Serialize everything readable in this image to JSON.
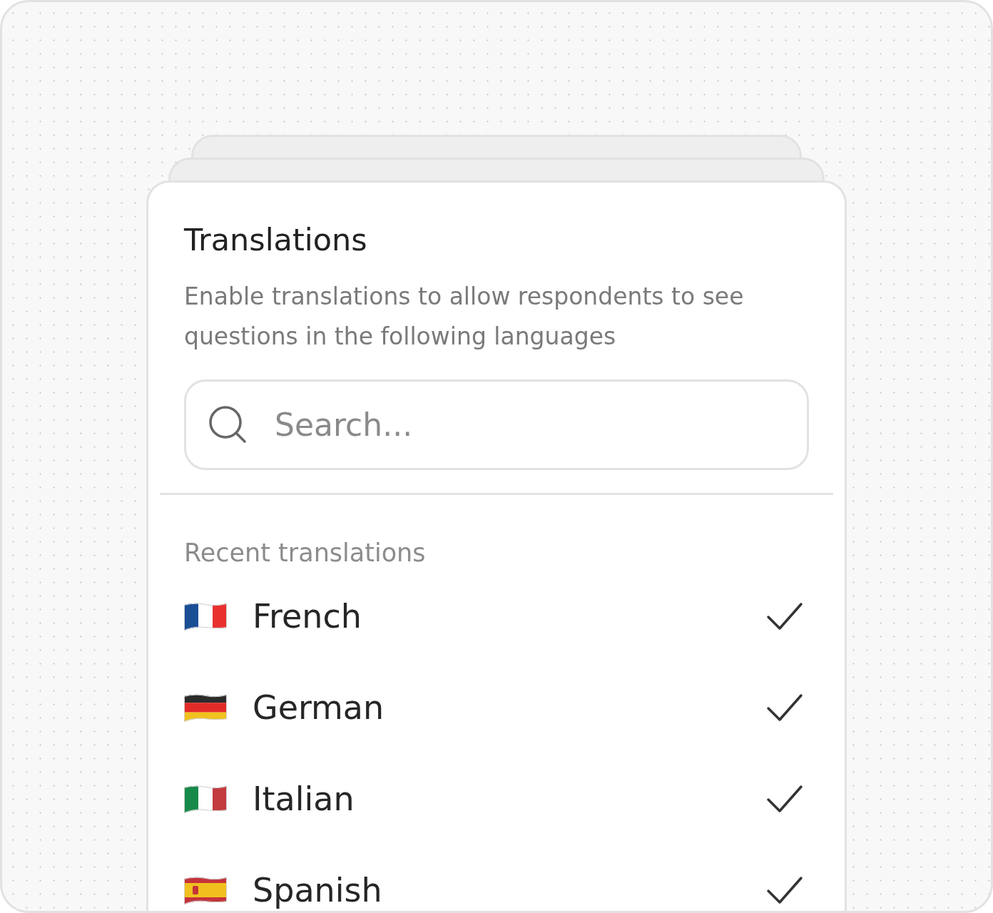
{
  "card": {
    "title": "Translations",
    "description": "Enable translations to allow respondents to see questions in the following languages"
  },
  "search": {
    "placeholder": "Search..."
  },
  "section_label": "Recent translations",
  "languages": [
    {
      "name": "French",
      "selected": true,
      "kind": "france"
    },
    {
      "name": "German",
      "selected": true,
      "kind": "germany"
    },
    {
      "name": "Italian",
      "selected": true,
      "kind": "italy"
    },
    {
      "name": "Spanish",
      "selected": true,
      "kind": "spain"
    }
  ]
}
